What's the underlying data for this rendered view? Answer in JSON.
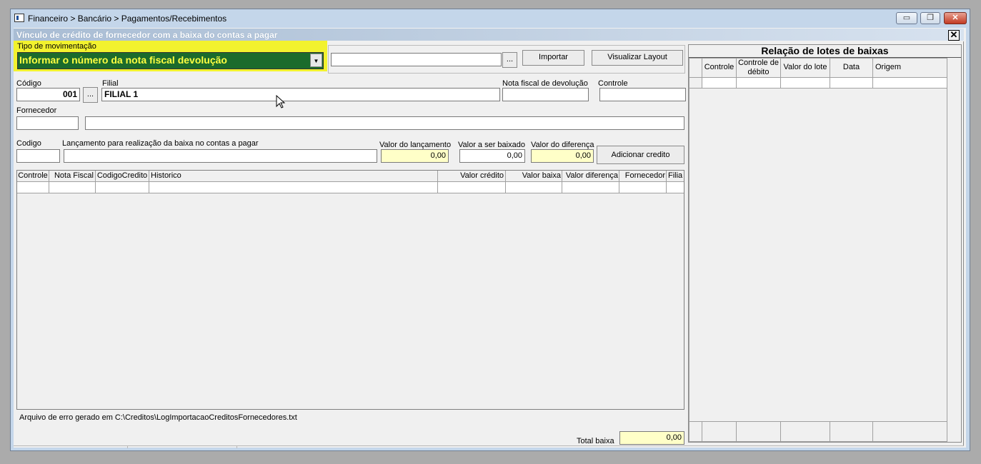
{
  "window": {
    "title": "Financeiro > Bancário > Pagamentos/Recebimentos",
    "subtitle": "Vínculo de crédito de fornecedor com a baixa do contas a pagar",
    "buttons": {
      "minimize": "▭",
      "restore": "❐",
      "close": "✕"
    },
    "inner_close": "✕"
  },
  "tipo": {
    "label": "Tipo de  movimentação",
    "value": "Informar o número da nota fiscal devolução",
    "arrow": "▼"
  },
  "import": {
    "file_value": "",
    "browse_label": "...",
    "import_label": "Importar",
    "layout_label": "Visualizar Layout"
  },
  "form": {
    "codigo_label": "Código",
    "codigo_value": "001",
    "codigo_browse": "...",
    "filial_label": "Filial",
    "filial_value": "FILIAL 1",
    "nf_dev_label": "Nota fiscal de devolução",
    "nf_dev_value": "",
    "controle_label": "Controle",
    "controle_value": "",
    "fornecedor_label": "Fornecedor",
    "fornecedor_code": "",
    "fornecedor_name": "",
    "codigo2_label": "Codigo",
    "codigo2_value": "",
    "lancamento_label": "Lançamento para realização da baixa no contas a pagar",
    "lancamento_value": "",
    "valor_lanc_label": "Valor do lançamento",
    "valor_lanc_value": "0,00",
    "valor_baixar_label": "Valor a ser baixado",
    "valor_baixar_value": "0,00",
    "valor_dif_label": "Valor do diferença",
    "valor_dif_value": "0,00",
    "add_credito_label": "Adicionar credito"
  },
  "main_grid": {
    "columns": [
      "Controle",
      "Nota Fiscal",
      "CodigoCredito",
      "Historico",
      "Valor crédito",
      "Valor baixa",
      "Valor diferença",
      "Fornecedor",
      "Filia"
    ]
  },
  "error_message": "Arquivo de erro gerado em C:\\Creditos\\LogImportacaoCreditosFornecedores.txt",
  "total": {
    "label": "Total baixa",
    "value": "0,00"
  },
  "lotes": {
    "title": "Relação de lotes de baixas",
    "columns": [
      "Controle",
      "Controle de débito",
      "Valor do lote",
      "Data",
      "Origem"
    ]
  }
}
